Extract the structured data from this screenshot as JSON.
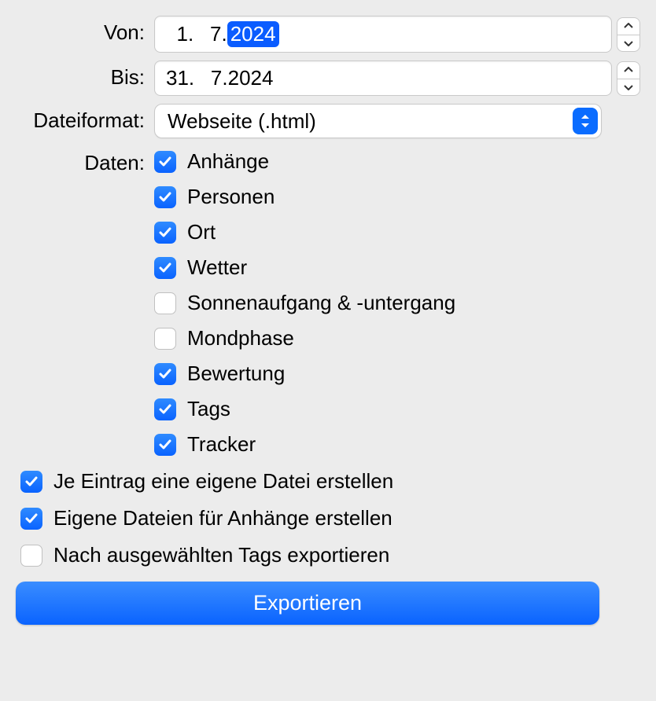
{
  "labels": {
    "von": "Von:",
    "bis": "Bis:",
    "format": "Dateiformat:",
    "daten": "Daten:"
  },
  "dates": {
    "von": {
      "day": "1",
      "month": "7",
      "year": "2024",
      "selected": "year"
    },
    "bis": {
      "day": "31",
      "month": "7",
      "year": "2024",
      "selected": null
    }
  },
  "format": {
    "value": "Webseite (.html)"
  },
  "data_options": [
    {
      "label": "Anhänge",
      "checked": true
    },
    {
      "label": "Personen",
      "checked": true
    },
    {
      "label": "Ort",
      "checked": true
    },
    {
      "label": "Wetter",
      "checked": true
    },
    {
      "label": "Sonnenaufgang & -untergang",
      "checked": false
    },
    {
      "label": "Mondphase",
      "checked": false
    },
    {
      "label": "Bewertung",
      "checked": true
    },
    {
      "label": "Tags",
      "checked": true
    },
    {
      "label": "Tracker",
      "checked": true
    }
  ],
  "extra_options": [
    {
      "label": "Je Eintrag eine eigene Datei erstellen",
      "checked": true
    },
    {
      "label": "Eigene Dateien für Anhänge erstellen",
      "checked": true
    },
    {
      "label": "Nach ausgewählten Tags exportieren",
      "checked": false
    }
  ],
  "export_button": "Exportieren"
}
